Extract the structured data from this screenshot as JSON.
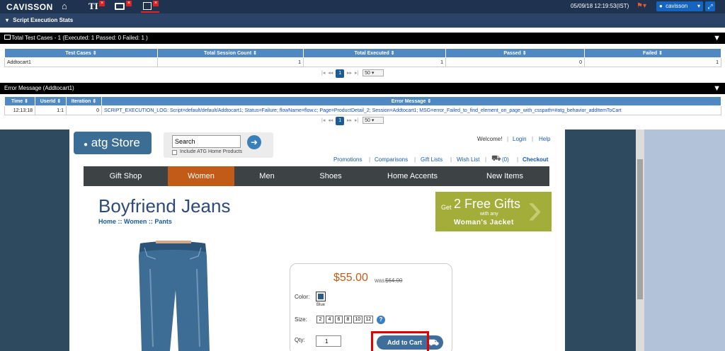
{
  "topbar": {
    "brand": "CAVISSON",
    "datetime": "05/09/18 12:19:53(IST)",
    "user": "cavisson",
    "tab_glyph": "TI"
  },
  "section_title": "Script Execution Stats",
  "summary": {
    "title": "Total Test Cases - 1 (Executed: 1 Passed: 0 Failed: 1 )",
    "columns": [
      "Test Cases",
      "Total Session Count",
      "Total Executed",
      "Passed",
      "Failed"
    ],
    "rows": [
      [
        "Addtocart1",
        "1",
        "1",
        "0",
        "1"
      ]
    ],
    "page": "1",
    "page_size": "50"
  },
  "errors": {
    "title": "Error Message (Addtocart1)",
    "columns": [
      "Time",
      "UserId",
      "Iteration",
      "Error Message"
    ],
    "rows": [
      [
        "12:13:18",
        "1:1",
        "0",
        "SCRIPT_EXECUTION_LOG: Script=default/default/Addtocart1; Status=Failure; flowName=flow.c; Page=ProductDetail_2; Session=Addtocart1; MSG=error_Failed_to_find_element_on_page_with_csspath=#atg_behavior_addItemToCart"
      ]
    ],
    "page": "1",
    "page_size": "50"
  },
  "store": {
    "logo": "atg Store",
    "search_value": "Search",
    "include_home": "Include ATG Home Products",
    "welcome": "Welcome!",
    "login": "Login",
    "help": "Help",
    "links": [
      "Promotions",
      "Comparisons",
      "Gift Lists",
      "Wish List"
    ],
    "cart_count": "(0)",
    "checkout": "Checkout",
    "nav": [
      "Gift Shop",
      "Women",
      "Men",
      "Shoes",
      "Home Accents",
      "New Items"
    ],
    "product_title": "Boyfriend Jeans",
    "breadcrumb": "Home :: Women :: Pants",
    "promo_prefix": "Get",
    "promo_main": "2 Free Gifts",
    "promo_mid": "with any",
    "promo_sub": "Woman's Jacket",
    "price": "$55.00",
    "was_label": "was",
    "was_price": "$64.00",
    "color_label": "Color:",
    "color_value": "Blue",
    "size_label": "Size:",
    "sizes": [
      "2",
      "4",
      "6",
      "8",
      "10",
      "12"
    ],
    "qty_label": "Qty:",
    "qty_value": "1",
    "add_to_cart": "Add to Cart",
    "help_glyph": "?"
  },
  "colors": {
    "topbar": "#1f3350",
    "accent": "#4f88c3",
    "nav": "#3d4245",
    "nav_active": "#c15b17",
    "promo": "#a2ad3a",
    "highlight": "#e00000"
  }
}
